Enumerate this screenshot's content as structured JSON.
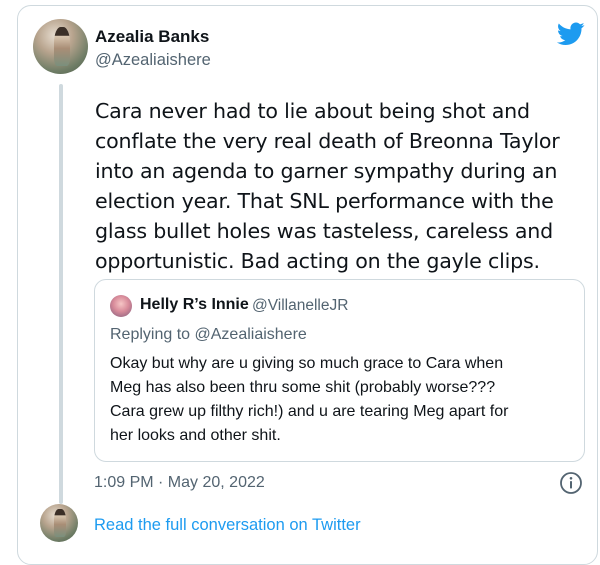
{
  "tweet": {
    "author_name": "Azealia Banks",
    "author_handle": "@Azealiaishere",
    "text_lines": [
      "Cara never had to lie about being shot and",
      "conflate the very real death of Breonna Taylor",
      "into an agenda to garner sympathy during an",
      "election year. That SNL performance with the",
      "glass bullet holes was tasteless, careless and",
      "opportunistic. Bad acting on the gayle clips."
    ],
    "timestamp": "1:09 PM · May 20, 2022"
  },
  "quoted_tweet": {
    "author_name": "Helly R’s Innie",
    "author_handle": "@VillanelleJR",
    "replying_prefix": "Replying to ",
    "replying_to": "@Azealiaishere",
    "text_lines": [
      "Okay but why are u giving so much grace to Cara when",
      "Meg has also been thru some shit (probably worse???",
      "Cara grew up filthy rich!) and u are tearing Meg apart for",
      "her looks and other shit."
    ]
  },
  "footer": {
    "read_link": "Read the full conversation on Twitter"
  },
  "icons": {
    "brand": "twitter-bird-icon",
    "info": "info-icon"
  },
  "colors": {
    "link": "#1d9bf0",
    "secondary_text": "#536471",
    "border": "#cfd9de"
  }
}
